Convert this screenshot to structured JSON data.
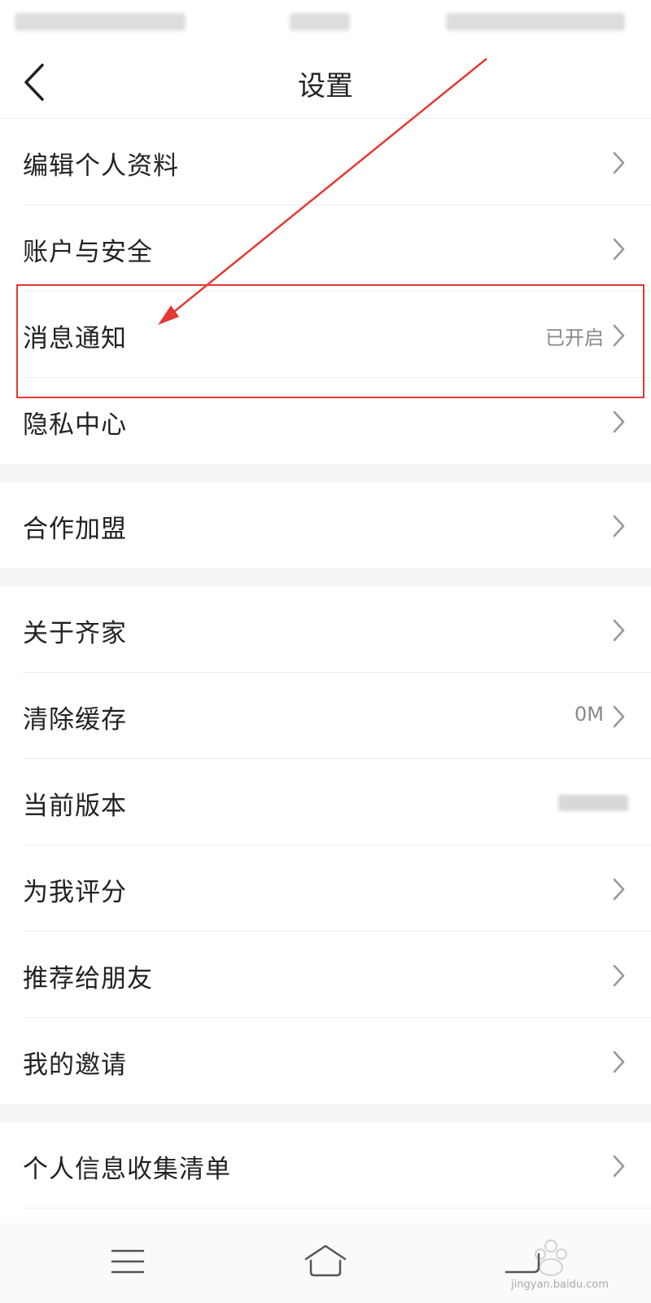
{
  "header": {
    "title": "设置"
  },
  "groups": [
    {
      "items": [
        {
          "label": "编辑个人资料",
          "value": ""
        },
        {
          "label": "账户与安全",
          "value": ""
        },
        {
          "label": "消息通知",
          "value": "已开启"
        },
        {
          "label": "隐私中心",
          "value": ""
        }
      ]
    },
    {
      "items": [
        {
          "label": "合作加盟",
          "value": ""
        }
      ]
    },
    {
      "items": [
        {
          "label": "关于齐家",
          "value": ""
        },
        {
          "label": "清除缓存",
          "value": "0M"
        },
        {
          "label": "当前版本",
          "value": ""
        },
        {
          "label": "为我评分",
          "value": ""
        },
        {
          "label": "推荐给朋友",
          "value": ""
        },
        {
          "label": "我的邀请",
          "value": ""
        }
      ]
    },
    {
      "items": [
        {
          "label": "个人信息收集清单",
          "value": ""
        }
      ]
    }
  ],
  "annotation": {
    "color": "#e53935",
    "highlighted_item": "消息通知"
  },
  "navbar": {
    "icons": [
      "menu-icon",
      "home-icon",
      "back-nav-icon"
    ]
  },
  "watermark": {
    "text": "jingyan.baidu.com"
  }
}
